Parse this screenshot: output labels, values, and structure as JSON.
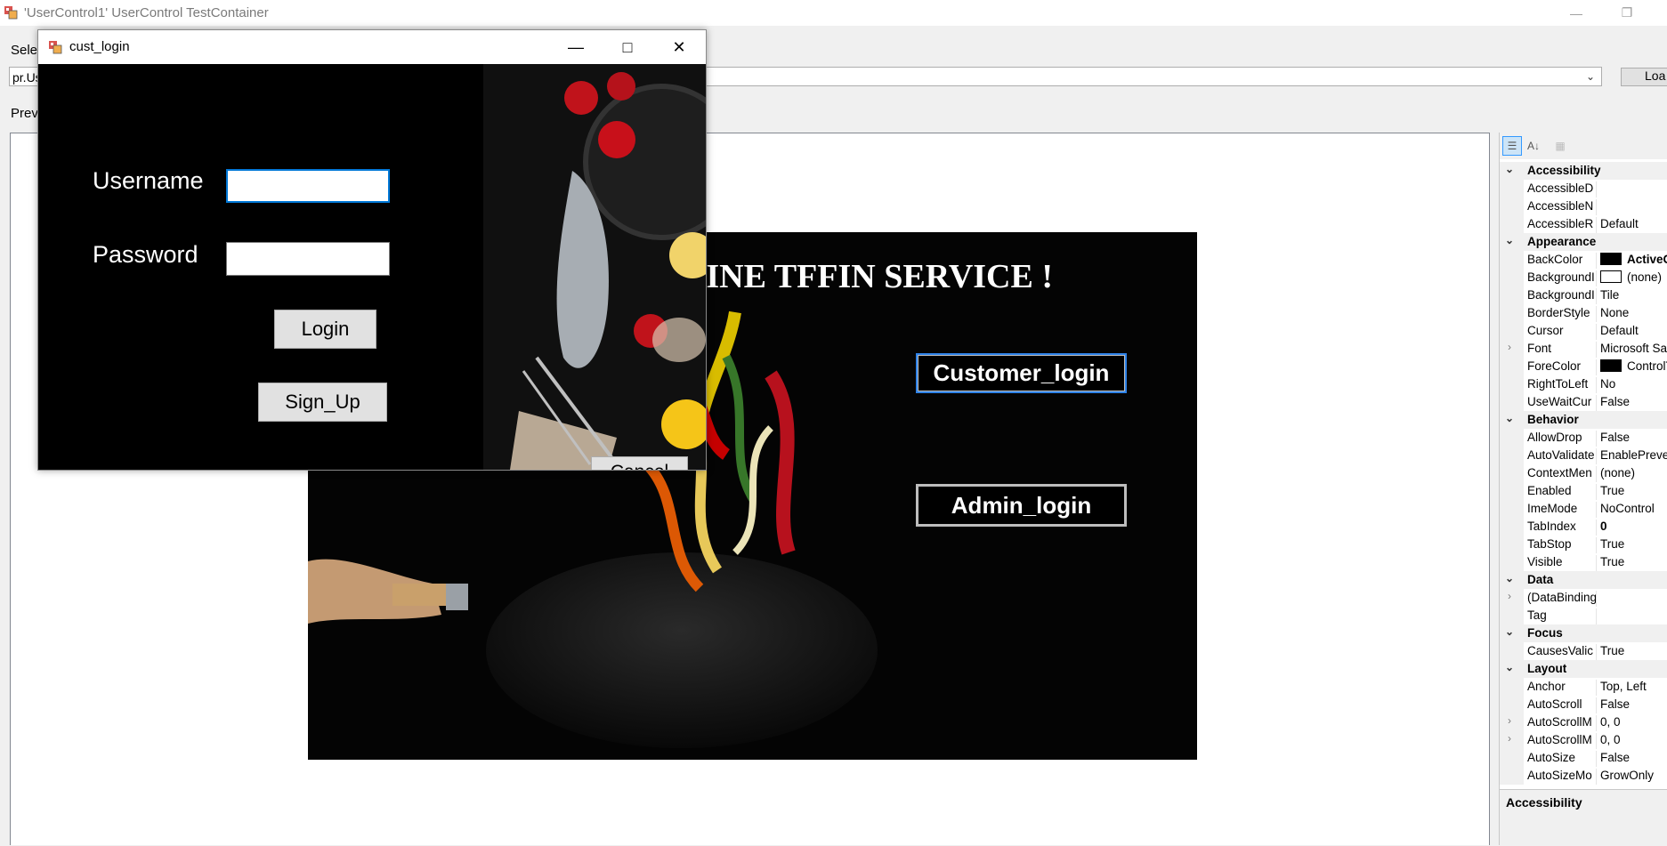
{
  "outer": {
    "title": "'UserControl1' UserControl TestContainer",
    "select_label": "Selec",
    "combo_value": "pr.Us",
    "load_label": "Loa",
    "preview_label": "Prev"
  },
  "usercontrol": {
    "title": "LINE TFFIN SERVICE !",
    "customer_login": "Customer_login",
    "admin_login": "Admin_login"
  },
  "login_window": {
    "title": "cust_login",
    "username_label": "Username",
    "password_label": "Password",
    "username_value": "",
    "password_value": "",
    "login_button": "Login",
    "signup_button": "Sign_Up",
    "cancel_button": "Cancel"
  },
  "propgrid": {
    "description_title": "Accessibility",
    "sections": [
      {
        "category": "Accessibility",
        "props": [
          {
            "name": "AccessibleD",
            "value": ""
          },
          {
            "name": "AccessibleN",
            "value": ""
          },
          {
            "name": "AccessibleR",
            "value": "Default"
          }
        ]
      },
      {
        "category": "Appearance",
        "props": [
          {
            "name": "BackColor",
            "value": "ActiveC",
            "swatch": "#000000",
            "bold": true
          },
          {
            "name": "BackgroundI",
            "value": "(none)",
            "swatch": "#ffffff"
          },
          {
            "name": "BackgroundI",
            "value": "Tile"
          },
          {
            "name": "BorderStyle",
            "value": "None"
          },
          {
            "name": "Cursor",
            "value": "Default"
          },
          {
            "name": "Font",
            "value": "Microsoft San",
            "expand": true
          },
          {
            "name": "ForeColor",
            "value": "ControlT",
            "swatch": "#000000"
          },
          {
            "name": "RightToLeft",
            "value": "No"
          },
          {
            "name": "UseWaitCur",
            "value": "False"
          }
        ]
      },
      {
        "category": "Behavior",
        "props": [
          {
            "name": "AllowDrop",
            "value": "False"
          },
          {
            "name": "AutoValidate",
            "value": "EnablePreve"
          },
          {
            "name": "ContextMen",
            "value": "(none)"
          },
          {
            "name": "Enabled",
            "value": "True"
          },
          {
            "name": "ImeMode",
            "value": "NoControl"
          },
          {
            "name": "TabIndex",
            "value": "0",
            "bold": true
          },
          {
            "name": "TabStop",
            "value": "True"
          },
          {
            "name": "Visible",
            "value": "True"
          }
        ]
      },
      {
        "category": "Data",
        "props": [
          {
            "name": "(DataBinding",
            "value": "",
            "expand": true
          },
          {
            "name": "Tag",
            "value": ""
          }
        ]
      },
      {
        "category": "Focus",
        "props": [
          {
            "name": "CausesValic",
            "value": "True"
          }
        ]
      },
      {
        "category": "Layout",
        "props": [
          {
            "name": "Anchor",
            "value": "Top, Left"
          },
          {
            "name": "AutoScroll",
            "value": "False"
          },
          {
            "name": "AutoScrollM",
            "value": "0, 0",
            "expand": true
          },
          {
            "name": "AutoScrollM",
            "value": "0, 0",
            "expand": true
          },
          {
            "name": "AutoSize",
            "value": "False"
          },
          {
            "name": "AutoSizeMo",
            "value": "GrowOnly"
          }
        ]
      }
    ]
  }
}
